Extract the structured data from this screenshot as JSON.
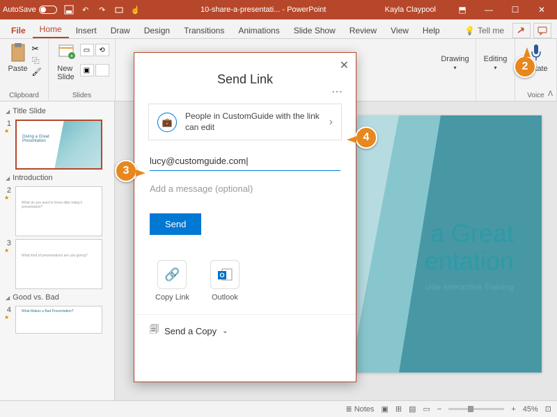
{
  "titlebar": {
    "autosave": "AutoSave",
    "filename": "10-share-a-presentati...",
    "app": "PowerPoint",
    "user": "Kayla Claypool"
  },
  "tabs": {
    "file": "File",
    "home": "Home",
    "insert": "Insert",
    "draw": "Draw",
    "design": "Design",
    "transitions": "Transitions",
    "animations": "Animations",
    "slideshow": "Slide Show",
    "review": "Review",
    "view": "View",
    "help": "Help",
    "tellme": "Tell me"
  },
  "ribbon": {
    "paste": "Paste",
    "clipboard": "Clipboard",
    "newslide": "New\nSlide",
    "slides": "Slides",
    "drawing": "Drawing",
    "editing": "Editing",
    "dictate": "Dictate",
    "voice": "Voice"
  },
  "thumbsections": [
    {
      "title": "Title Slide",
      "slides": [
        {
          "num": "1",
          "title": "Giving a Great\nPresentation"
        }
      ]
    },
    {
      "title": "Introduction",
      "slides": [
        {
          "num": "2",
          "body": "What do you want to know after today's presentation?"
        },
        {
          "num": "3",
          "body": "What kind of presentations are you giving?"
        }
      ]
    },
    {
      "title": "Good vs. Bad",
      "slides": [
        {
          "num": "4",
          "title": "What Makes a Bad Presentation?"
        }
      ]
    }
  ],
  "slide": {
    "title": "a Great\nentation",
    "subtitle": "uide Interactive Training"
  },
  "dialog": {
    "title": "Send Link",
    "permission": "People in CustomGuide with the link can edit",
    "email": "lucy@customguide.com",
    "message_placeholder": "Add a message (optional)",
    "send": "Send",
    "copylink": "Copy Link",
    "outlook": "Outlook",
    "sendcopy": "Send a Copy"
  },
  "status": {
    "notes": "Notes",
    "zoom": "45%"
  },
  "callouts": {
    "c2": "2",
    "c3": "3",
    "c4": "4"
  },
  "colors": {
    "accent": "#b7472a",
    "blue": "#0078d4",
    "callout": "#e8871e",
    "teal": "#2d9aa8"
  }
}
